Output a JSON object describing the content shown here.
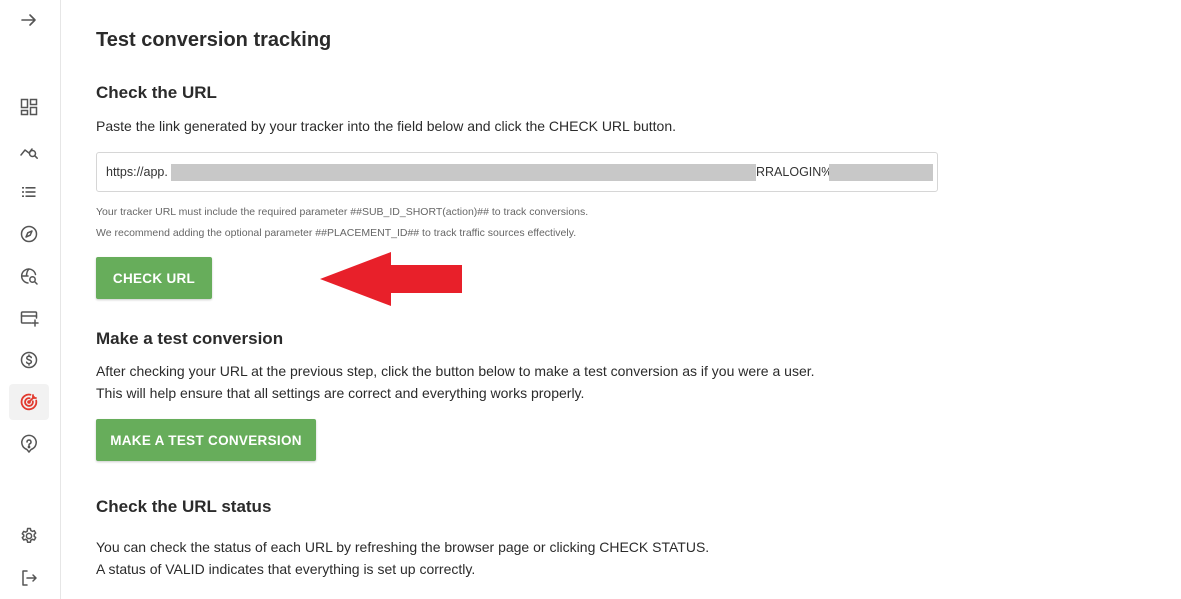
{
  "sidebar": {
    "items": [
      {
        "name": "arrow-right-icon"
      },
      {
        "name": "dashboard-icon"
      },
      {
        "name": "analytics-search-icon"
      },
      {
        "name": "list-icon"
      },
      {
        "name": "compass-icon"
      },
      {
        "name": "globe-search-icon"
      },
      {
        "name": "card-add-icon"
      },
      {
        "name": "dollar-icon"
      },
      {
        "name": "target-icon",
        "active": true
      },
      {
        "name": "help-icon"
      },
      {
        "name": "gear-icon"
      },
      {
        "name": "logout-icon"
      }
    ]
  },
  "page": {
    "title": "Test conversion tracking"
  },
  "check_url": {
    "title": "Check the URL",
    "description": "Paste the link generated by your tracker into the field below and click the CHECK URL button.",
    "url_prefix": "https://app.",
    "url_middle": "RRALOGIN%2",
    "hint1": "Your tracker URL must include the required parameter ##SUB_ID_SHORT(action)## to track conversions.",
    "hint2": "We recommend adding the optional parameter ##PLACEMENT_ID## to track traffic sources effectively.",
    "button_label": "CHECK URL"
  },
  "test_conversion": {
    "title": "Make a test conversion",
    "line1": "After checking your URL at the previous step, click the button below to make a test conversion as if you were a user.",
    "line2": "This will help ensure that all settings are correct and everything works properly.",
    "button_label": "MAKE A TEST CONVERSION"
  },
  "url_status": {
    "title": "Check the URL status",
    "line1": "You can check the status of each URL by refreshing the browser page or clicking CHECK STATUS.",
    "line2": "A status of VALID indicates that everything is set up correctly."
  },
  "colors": {
    "accent_green": "#67ad5b",
    "annotation_red": "#e8202a",
    "active_icon_red": "#e23a2e"
  }
}
